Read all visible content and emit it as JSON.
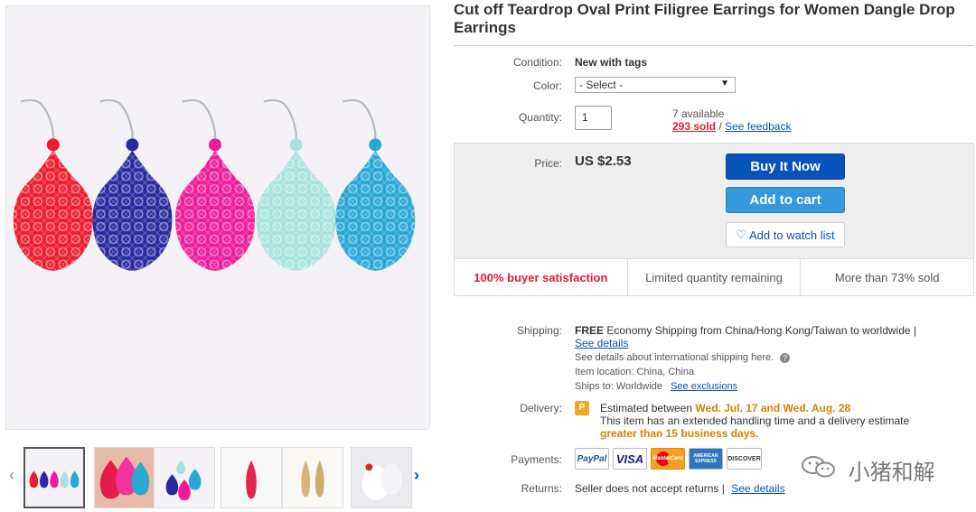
{
  "product": {
    "title": "Cut off Teardrop Oval Print Filigree Earrings for Women Dangle Drop Earrings"
  },
  "details": {
    "condition_label": "Condition:",
    "condition_value": "New with tags",
    "color_label": "Color:",
    "color_select": "- Select -",
    "quantity_label": "Quantity:",
    "quantity_value": "1",
    "available": "7 available",
    "sold": "293 sold",
    "separator": "/",
    "feedback": "See feedback"
  },
  "purchase": {
    "price_label": "Price:",
    "price": "US $2.53",
    "buy_now": "Buy It Now",
    "add_to_cart": "Add to cart",
    "watch_list": "Add to watch list"
  },
  "badges": [
    "100% buyer satisfaction",
    "Limited quantity remaining",
    "More than 73% sold"
  ],
  "shipping": {
    "label": "Shipping:",
    "free": "FREE",
    "desc": "Economy Shipping from China/Hong Kong/Taiwan to worldwide |",
    "see_details": "See details",
    "intl_note": "See details about international shipping here.",
    "location_label": "Item location:",
    "location": "China, China",
    "ships_label": "Ships to:",
    "ships_to": "Worldwide",
    "exclusions": "See exclusions"
  },
  "delivery": {
    "label": "Delivery:",
    "est_prefix": "Estimated between",
    "est_range": "Wed. Jul. 17 and Wed. Aug. 28",
    "note": "This item has an extended handling time and a delivery estimate",
    "note2": "greater than 15 business days."
  },
  "payments": {
    "label": "Payments:",
    "methods": [
      "PayPal",
      "VISA",
      "MasterCard",
      "AMERICAN EXPRESS",
      "DISCOVER"
    ]
  },
  "returns": {
    "label": "Returns:",
    "text": "Seller does not accept returns |",
    "link": "See details"
  },
  "watermark": "小猪和解",
  "colors": {
    "earrings": [
      "#ee1c2e",
      "#2a2aa0",
      "#f01b9a",
      "#a9e3df",
      "#29a8d6"
    ],
    "link": "#0654ba",
    "buy": "#0654ba",
    "cart": "#3498db",
    "alert": "#dd1e31",
    "orange": "#d68000"
  }
}
